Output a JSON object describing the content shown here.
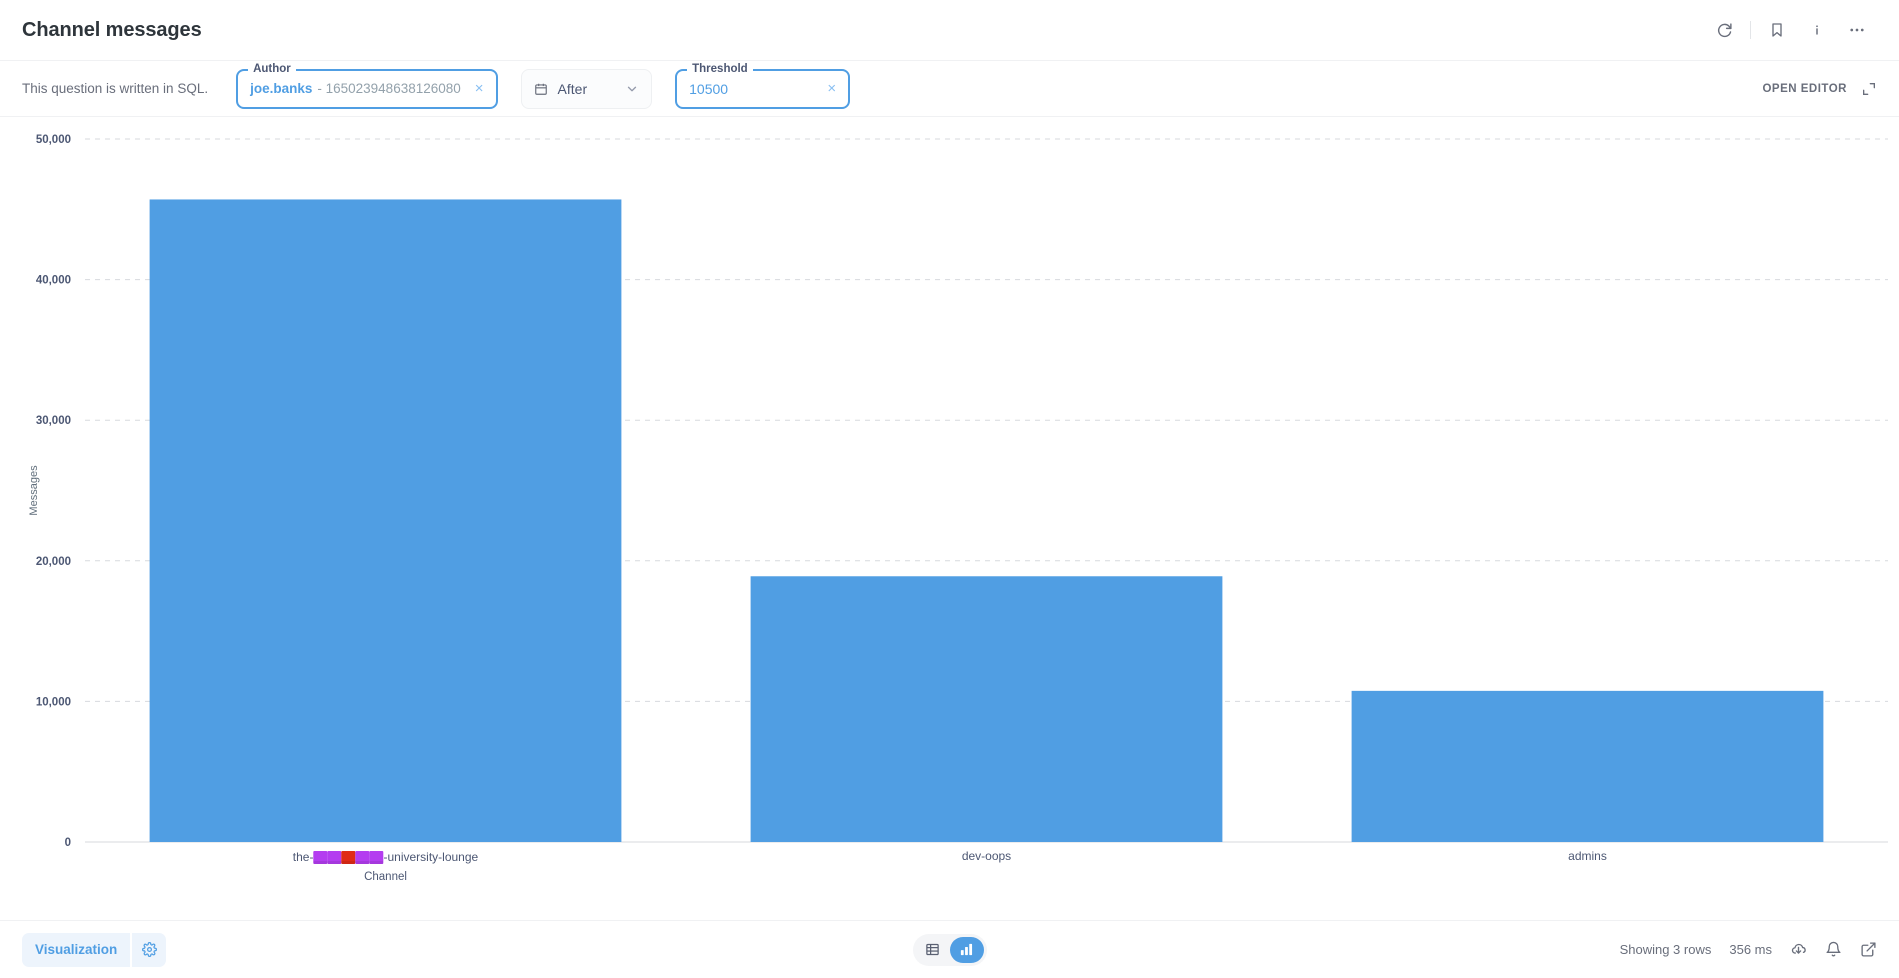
{
  "header": {
    "title": "Channel messages",
    "icons": [
      {
        "name": "refresh-icon",
        "glyph": "refresh"
      },
      {
        "name": "bookmark-icon",
        "glyph": "bookmark"
      },
      {
        "name": "info-icon",
        "glyph": "info"
      },
      {
        "name": "more-icon",
        "glyph": "ellipsis"
      }
    ]
  },
  "filterbar": {
    "sql_note": "This question is written in SQL.",
    "author": {
      "legend": "Author",
      "value_primary": "joe.banks",
      "value_secondary": "- 165023948638126080",
      "clear": "×"
    },
    "date": {
      "label": "After",
      "icon": "calendar-icon",
      "chevron": "chevron-down-icon"
    },
    "threshold": {
      "legend": "Threshold",
      "value": "10500",
      "clear": "×"
    },
    "open_editor_label": "OPEN EDITOR"
  },
  "chart_data": {
    "type": "bar",
    "title": "",
    "categories": [
      "the-⬛⬛⬛-university-lounge",
      "dev-oops",
      "admins"
    ],
    "category_labels_display": [
      "the-[emoji]-university-lounge",
      "dev-oops",
      "admins"
    ],
    "values": [
      45700,
      18900,
      10750
    ],
    "xlabel": "Channel",
    "ylabel": "Messages",
    "ylim": [
      0,
      50000
    ],
    "yticks": [
      0,
      10000,
      20000,
      30000,
      40000,
      50000
    ],
    "ytick_labels": [
      "0",
      "10,000",
      "20,000",
      "30,000",
      "40,000",
      "50,000"
    ],
    "grid": true,
    "legend": false,
    "bar_color": "#509ee3"
  },
  "footer": {
    "visualization_label": "Visualization",
    "gear_icon": "gear-icon",
    "toggle": {
      "table_icon": "table-icon",
      "chart_icon": "bar-chart-icon",
      "active": "chart"
    },
    "rows_text": "Showing 3 rows",
    "duration_text": "356 ms",
    "icons": [
      {
        "name": "download-icon"
      },
      {
        "name": "alert-bell-icon"
      },
      {
        "name": "share-external-icon"
      }
    ]
  },
  "colors": {
    "accent": "#509ee3",
    "text": "#4c5773",
    "muted": "#696e7b"
  }
}
